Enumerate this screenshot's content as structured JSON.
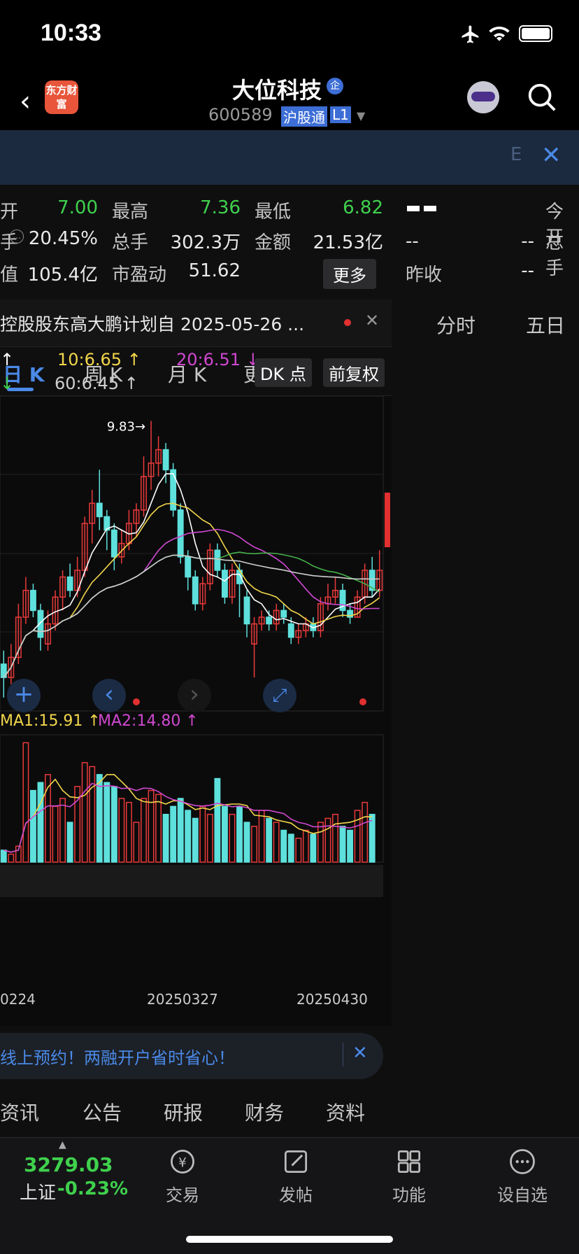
{
  "status": {
    "time": "10:33"
  },
  "header": {
    "stock_name": "大位科技",
    "badge": "企",
    "code": "600589",
    "tag1": "沪股通",
    "tag2": "L1",
    "logo_text": "东方财富"
  },
  "banner": {
    "text": "E"
  },
  "quote": {
    "open_label": "开",
    "open": "7.00",
    "high_label": "最高",
    "high": "7.36",
    "low_label": "最低",
    "low": "6.82",
    "turnover_label": "手",
    "turnover": "20.45%",
    "vol_label": "总手",
    "vol": "302.3万",
    "amt_label": "金额",
    "amt": "21.53亿",
    "mcap_label": "值",
    "mcap": "105.4亿",
    "pe_label": "市盈动",
    "pe": "51.62",
    "more": "更多",
    "right_dash1": "--",
    "right_dash2": "--",
    "right_dash3": "--",
    "right_dash4": "--",
    "today_open": "今开",
    "total_hand": "总手",
    "prev_close": "昨收"
  },
  "notice": {
    "text": "控股股东高大鹏计划自 2025-05-26 ..."
  },
  "right_tabs": [
    "分时",
    "五日"
  ],
  "ktabs": [
    "日 K",
    "周 K",
    "月 K",
    "更多"
  ],
  "ma": {
    "ma10": "10:6.65 ↑",
    "ma20": "20:6.51 ↓",
    "ma60": "60:6.45 ↑",
    "dk": "DK 点",
    "fq": "前复权",
    "max_label": "9.83→"
  },
  "vol_ma": {
    "ma1": "MA1:15.91 ↑",
    "ma2": "MA2:14.80 ↑"
  },
  "x_axis": [
    "0224",
    "20250327",
    "20250430"
  ],
  "promo": {
    "text": "线上预约！两融开户省时省心！"
  },
  "info_tabs": [
    "资讯",
    "公告",
    "研报",
    "财务",
    "资料"
  ],
  "bottom": {
    "index_value": "3279.03",
    "index_name": "上证",
    "index_change": "-0.23%",
    "items": [
      "交易",
      "发帖",
      "功能",
      "设自选"
    ]
  },
  "chart_data": {
    "type": "candlestick",
    "max_price_label": "9.83",
    "candles": [
      {
        "o": 6.2,
        "c": 6.0,
        "h": 6.4,
        "l": 5.7
      },
      {
        "o": 6.0,
        "c": 6.3,
        "h": 6.5,
        "l": 5.9
      },
      {
        "o": 6.3,
        "c": 6.9,
        "h": 7.1,
        "l": 6.2
      },
      {
        "o": 6.9,
        "c": 7.3,
        "h": 7.5,
        "l": 6.8
      },
      {
        "o": 7.3,
        "c": 7.0,
        "h": 7.4,
        "l": 6.9
      },
      {
        "o": 7.0,
        "c": 6.6,
        "h": 7.1,
        "l": 6.4
      },
      {
        "o": 6.5,
        "c": 6.8,
        "h": 7.0,
        "l": 6.4
      },
      {
        "o": 6.8,
        "c": 7.2,
        "h": 7.3,
        "l": 6.7
      },
      {
        "o": 7.2,
        "c": 7.5,
        "h": 7.6,
        "l": 7.0
      },
      {
        "o": 7.5,
        "c": 7.3,
        "h": 7.7,
        "l": 7.2
      },
      {
        "o": 7.3,
        "c": 7.6,
        "h": 7.8,
        "l": 7.2
      },
      {
        "o": 7.6,
        "c": 8.3,
        "h": 8.4,
        "l": 7.5
      },
      {
        "o": 8.3,
        "c": 8.6,
        "h": 8.8,
        "l": 8.0
      },
      {
        "o": 8.6,
        "c": 8.4,
        "h": 9.1,
        "l": 8.2
      },
      {
        "o": 8.4,
        "c": 8.2,
        "h": 8.5,
        "l": 7.9
      },
      {
        "o": 8.2,
        "c": 7.8,
        "h": 8.3,
        "l": 7.6
      },
      {
        "o": 7.8,
        "c": 8.0,
        "h": 8.2,
        "l": 7.7
      },
      {
        "o": 8.0,
        "c": 8.3,
        "h": 8.5,
        "l": 7.9
      },
      {
        "o": 8.3,
        "c": 8.5,
        "h": 8.6,
        "l": 8.1
      },
      {
        "o": 8.5,
        "c": 9.0,
        "h": 9.3,
        "l": 8.4
      },
      {
        "o": 9.0,
        "c": 9.2,
        "h": 9.83,
        "l": 8.8
      },
      {
        "o": 9.2,
        "c": 9.4,
        "h": 9.6,
        "l": 9.0
      },
      {
        "o": 9.4,
        "c": 9.1,
        "h": 9.5,
        "l": 8.9
      },
      {
        "o": 9.1,
        "c": 8.5,
        "h": 9.2,
        "l": 8.4
      },
      {
        "o": 8.5,
        "c": 7.8,
        "h": 8.6,
        "l": 7.7
      },
      {
        "o": 7.8,
        "c": 7.5,
        "h": 7.9,
        "l": 7.3
      },
      {
        "o": 7.5,
        "c": 7.1,
        "h": 7.6,
        "l": 7.0
      },
      {
        "o": 7.1,
        "c": 7.4,
        "h": 7.5,
        "l": 7.0
      },
      {
        "o": 7.4,
        "c": 7.9,
        "h": 8.0,
        "l": 7.3
      },
      {
        "o": 7.9,
        "c": 7.6,
        "h": 8.0,
        "l": 7.5
      },
      {
        "o": 7.6,
        "c": 7.2,
        "h": 7.7,
        "l": 7.1
      },
      {
        "o": 7.2,
        "c": 7.6,
        "h": 7.7,
        "l": 7.1
      },
      {
        "o": 7.6,
        "c": 7.4,
        "h": 7.7,
        "l": 6.9
      },
      {
        "o": 7.2,
        "c": 6.8,
        "h": 7.3,
        "l": 6.6
      },
      {
        "o": 6.5,
        "c": 6.8,
        "h": 6.9,
        "l": 6.0
      },
      {
        "o": 6.8,
        "c": 6.9,
        "h": 7.0,
        "l": 6.7
      },
      {
        "o": 6.9,
        "c": 6.8,
        "h": 7.0,
        "l": 6.7
      },
      {
        "o": 6.8,
        "c": 7.0,
        "h": 7.1,
        "l": 6.7
      },
      {
        "o": 7.0,
        "c": 6.9,
        "h": 7.1,
        "l": 6.8
      },
      {
        "o": 6.8,
        "c": 6.6,
        "h": 6.9,
        "l": 6.5
      },
      {
        "o": 6.6,
        "c": 6.7,
        "h": 6.8,
        "l": 6.5
      },
      {
        "o": 6.7,
        "c": 6.8,
        "h": 6.9,
        "l": 6.6
      },
      {
        "o": 6.8,
        "c": 6.7,
        "h": 6.9,
        "l": 6.6
      },
      {
        "o": 6.7,
        "c": 7.1,
        "h": 7.2,
        "l": 6.6
      },
      {
        "o": 7.1,
        "c": 7.2,
        "h": 7.4,
        "l": 7.0
      },
      {
        "o": 7.2,
        "c": 7.3,
        "h": 7.5,
        "l": 7.1
      },
      {
        "o": 7.3,
        "c": 7.0,
        "h": 7.4,
        "l": 6.9
      },
      {
        "o": 7.0,
        "c": 6.9,
        "h": 7.1,
        "l": 6.8
      },
      {
        "o": 6.9,
        "c": 7.2,
        "h": 7.3,
        "l": 6.9
      },
      {
        "o": 7.2,
        "c": 7.6,
        "h": 7.7,
        "l": 7.1
      },
      {
        "o": 7.6,
        "c": 7.3,
        "h": 7.8,
        "l": 7.2
      },
      {
        "o": 7.3,
        "c": 7.6,
        "h": 7.9,
        "l": 7.2
      }
    ],
    "volumes": [
      3,
      2,
      4,
      30,
      18,
      20,
      22,
      14,
      16,
      10,
      19,
      25,
      24,
      22,
      20,
      19,
      16,
      15,
      10,
      16,
      18,
      17,
      12,
      14,
      16,
      13,
      11,
      14,
      12,
      21,
      14,
      12,
      14,
      10,
      9,
      13,
      11,
      10,
      8,
      7,
      6,
      8,
      7,
      10,
      11,
      12,
      9,
      8,
      13,
      15,
      12
    ],
    "ylim": [
      5.5,
      10.2
    ],
    "vlim": [
      0,
      32
    ]
  }
}
